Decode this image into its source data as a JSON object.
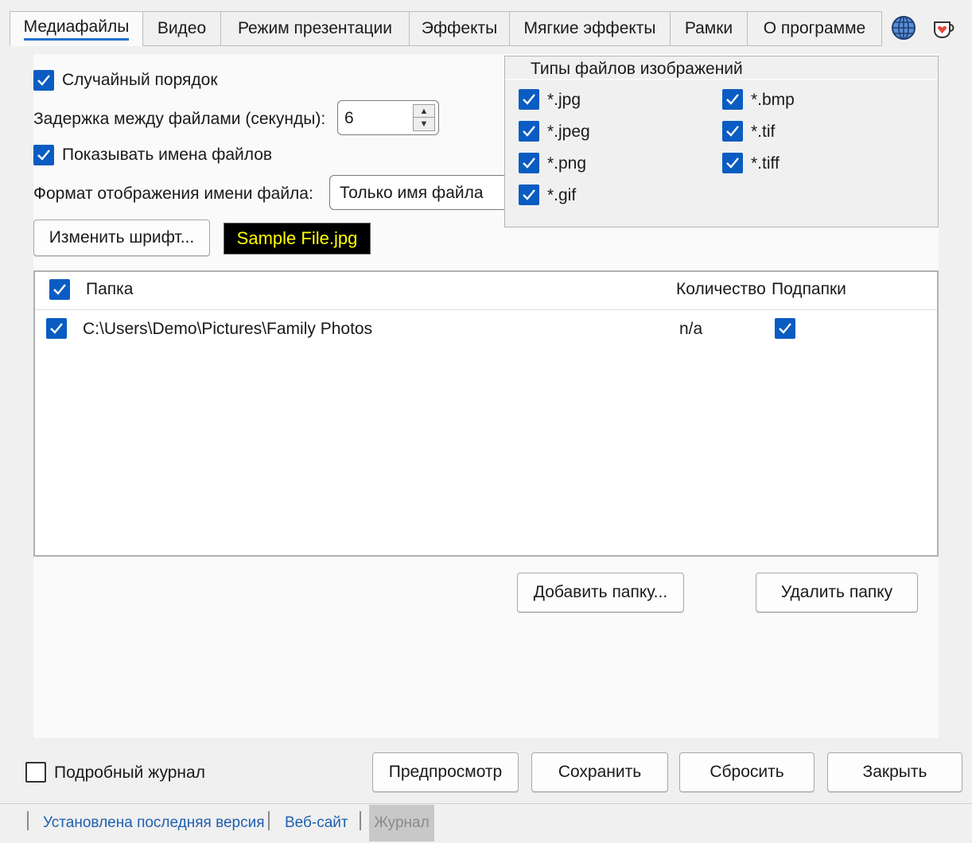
{
  "tabs": [
    {
      "label": "Медиафайлы",
      "active": true
    },
    {
      "label": "Видео"
    },
    {
      "label": "Режим презентации"
    },
    {
      "label": "Эффекты"
    },
    {
      "label": "Мягкие эффекты"
    },
    {
      "label": "Рамки"
    },
    {
      "label": "О программе"
    }
  ],
  "icons": {
    "language": "globe-icon",
    "donate": "coffee-heart-icon"
  },
  "options": {
    "random_order": {
      "label": "Случайный порядок",
      "checked": true
    },
    "delay_label": "Задержка между файлами (секунды):",
    "delay_value": "6",
    "show_names": {
      "label": "Показывать имена файлов",
      "checked": true
    },
    "name_format_label": "Формат отображения имени файла:",
    "name_format_value": "Только имя файла",
    "change_font_button": "Изменить шрифт...",
    "font_sample": "Sample File.jpg",
    "font_sample_colors": {
      "background": "#000000",
      "text": "#ffff00"
    }
  },
  "file_types": {
    "title": "Типы файлов изображений",
    "items": [
      {
        "label": "*.jpg",
        "checked": true
      },
      {
        "label": "*.bmp",
        "checked": true
      },
      {
        "label": "*.jpeg",
        "checked": true
      },
      {
        "label": "*.tif",
        "checked": true
      },
      {
        "label": "*.png",
        "checked": true
      },
      {
        "label": "*.tiff",
        "checked": true
      },
      {
        "label": "*.gif",
        "checked": true
      }
    ]
  },
  "folders": {
    "columns": [
      "Папка",
      "Количество",
      "Подпапки"
    ],
    "rows": [
      {
        "path": "C:\\Users\\Demo\\Pictures\\Family Photos",
        "count": "n/a",
        "subfolders": true,
        "checked": true
      }
    ],
    "add_button": "Добавить папку...",
    "remove_button": "Удалить папку"
  },
  "footer": {
    "verbose_log": {
      "label": "Подробный журнал",
      "checked": false
    },
    "preview_button": "Предпросмотр",
    "save_button": "Сохранить",
    "reset_button": "Сбросить",
    "close_button": "Закрыть"
  },
  "status": {
    "version_link": "Установлена последняя версия",
    "website_link": "Веб-сайт",
    "log_button": "Журнал"
  },
  "colors": {
    "accent": "#0a5cc2",
    "link": "#1f5fb0"
  }
}
